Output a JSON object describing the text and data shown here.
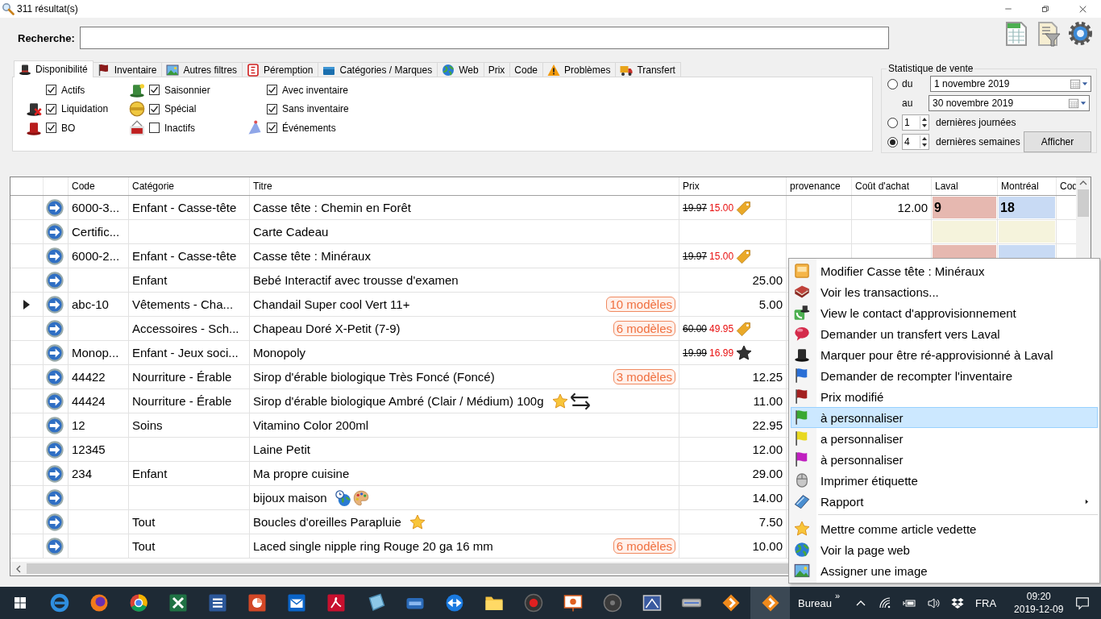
{
  "window": {
    "title": "311 résultat(s)"
  },
  "search": {
    "label": "Recherche:"
  },
  "tabs": [
    {
      "label": "Disponibilité",
      "kind": "hat",
      "selected": true
    },
    {
      "label": "Inventaire",
      "kind": "flag",
      "selected": false
    },
    {
      "label": "Autres filtres",
      "kind": "picture",
      "selected": false
    },
    {
      "label": "Péremption",
      "kind": "expiry",
      "selected": false
    },
    {
      "label": "Catégories / Marques",
      "kind": "box",
      "selected": false
    },
    {
      "label": "Web",
      "kind": "globe",
      "selected": false
    },
    {
      "label": "Prix",
      "selected": false
    },
    {
      "label": "Code",
      "selected": false
    },
    {
      "label": "Problèmes",
      "kind": "warning",
      "selected": false
    },
    {
      "label": "Transfert",
      "kind": "truck",
      "selected": false
    }
  ],
  "filter_columns": [
    {
      "items": [
        {
          "label": "Actifs",
          "checked": true
        },
        {
          "label": "Liquidation",
          "kind": "hat-cross",
          "checked": true
        },
        {
          "label": "BO",
          "kind": "hat-red",
          "checked": true
        }
      ]
    },
    {
      "items": [
        {
          "label": "Saisonnier",
          "kind": "hat-green",
          "checked": true
        },
        {
          "label": "Spécial",
          "kind": "seal",
          "checked": true
        },
        {
          "label": "Inactifs",
          "kind": "sign",
          "checked": false
        }
      ]
    },
    {
      "items": [
        {
          "label": "Avec inventaire",
          "checked": true
        },
        {
          "label": "Sans inventaire",
          "checked": true
        },
        {
          "label": "Événements",
          "kind": "party-hat",
          "checked": true
        }
      ]
    }
  ],
  "sales_stats": {
    "title": "Statistique de vente",
    "range": {
      "selected": false,
      "from_label": "du",
      "from": "1 novembre 2019",
      "to_label": "au",
      "to": "30 novembre 2019"
    },
    "days": {
      "selected": false,
      "value": "1",
      "label": "dernières journées"
    },
    "weeks": {
      "selected": true,
      "value": "4",
      "label": "dernières semaines"
    },
    "button": "Afficher"
  },
  "grid": {
    "columns": [
      "Code",
      "Catégorie",
      "Titre",
      "Prix",
      "provenance",
      "Coût d'achat",
      "Laval",
      "Montréal",
      "Cod"
    ],
    "rows": [
      {
        "current": false,
        "code": "6000-3...",
        "category": "Enfant - Casse-tête",
        "title": "Casse tête : Chemin en Forêt",
        "price": {
          "old": "19.97",
          "new": "15.00",
          "marker": {
            "kind": "tag"
          }
        },
        "cost": "12.00",
        "stock_tracked": true,
        "laval": "9",
        "montreal": "18"
      },
      {
        "current": false,
        "code": "Certific...",
        "title": "Carte Cadeau",
        "stock_tracked": false
      },
      {
        "current": false,
        "code": "6000-2...",
        "category": "Enfant - Casse-tête",
        "title": "Casse tête : Minéraux",
        "price": {
          "old": "19.97",
          "new": "15.00",
          "marker": {
            "kind": "tag"
          }
        },
        "stock_tracked": true
      },
      {
        "current": false,
        "category": "Enfant",
        "title": "Bebé Interactif avec trousse d'examen",
        "price": {
          "value": "25.00"
        }
      },
      {
        "current": true,
        "code": "abc-10",
        "category": "Vêtements - Cha...",
        "title": "Chandail Super cool Vert 11+",
        "variants": "10 modèles",
        "price": {
          "value": "5.00"
        }
      },
      {
        "current": false,
        "category": "Accessoires - Sch...",
        "title": "Chapeau Doré X-Petit (7-9)",
        "variants": "6 modèles",
        "price": {
          "old": "60.00",
          "new": "49.95",
          "marker": {
            "kind": "tag"
          }
        }
      },
      {
        "current": false,
        "code": "Monop...",
        "category": "Enfant - Jeux soci...",
        "title": "Monopoly",
        "price": {
          "old": "19.99",
          "new": "16.99",
          "marker": {
            "kind": "star-dark"
          }
        }
      },
      {
        "current": false,
        "code": "44422",
        "category": "Nourriture - Érable",
        "title": "Sirop d'érable biologique Très Foncé (Foncé)",
        "variants": "3 modèles",
        "price": {
          "value": "12.25"
        }
      },
      {
        "current": false,
        "code": "44424",
        "category": "Nourriture - Érable",
        "title": "Sirop d'érable biologique Ambré (Clair / Médium) 100g",
        "title_icons": [
          {
            "kind": "star"
          },
          {
            "kind": "swap"
          }
        ],
        "price": {
          "value": "11.00"
        }
      },
      {
        "current": false,
        "code": "12",
        "category": "Soins",
        "title": "Vitamino Color 200ml",
        "price": {
          "value": "22.95"
        }
      },
      {
        "current": false,
        "code": "12345",
        "title": "Laine Petit",
        "price": {
          "value": "12.00"
        }
      },
      {
        "current": false,
        "code": "234",
        "category": "Enfant",
        "title": "Ma propre cuisine",
        "price": {
          "value": "29.00"
        }
      },
      {
        "current": false,
        "title": "bijoux maison",
        "title_icons": [
          {
            "kind": "globe-clock"
          },
          {
            "kind": "palette"
          }
        ],
        "price": {
          "value": "14.00"
        }
      },
      {
        "current": false,
        "category": "Tout",
        "title": "Boucles d'oreilles Parapluie",
        "title_icons": [
          {
            "kind": "star"
          }
        ],
        "price": {
          "value": "7.50"
        }
      },
      {
        "current": false,
        "category": "Tout",
        "title": "Laced single nipple ring Rouge 20 ga 16 mm",
        "variants": "6 modèles",
        "price": {
          "value": "10.00"
        }
      }
    ]
  },
  "context_menu": {
    "items": [
      {
        "kind": "edit",
        "label": "Modifier Casse tête : Minéraux",
        "selected": false
      },
      {
        "kind": "book",
        "label": "Voir les transactions...",
        "selected": false
      },
      {
        "kind": "contact",
        "label": "View le contact d'approvisionnement",
        "selected": false
      },
      {
        "kind": "bubble",
        "label": "Demander un transfert vers Laval",
        "selected": false
      },
      {
        "kind": "hat",
        "label": "Marquer pour être ré-approvisionné à Laval",
        "selected": false
      },
      {
        "kind": "flag",
        "color": "#2a6fd6",
        "label": "Demander de recompter l'inventaire",
        "selected": false
      },
      {
        "kind": "flag",
        "color": "#a32020",
        "label": "Prix modifié",
        "selected": false
      },
      {
        "kind": "flag",
        "color": "#3aa832",
        "label": "à personnaliser",
        "selected": true
      },
      {
        "kind": "flag",
        "color": "#e8d820",
        "label": "a personnaliser",
        "selected": false
      },
      {
        "kind": "flag",
        "color": "#c020c0",
        "label": "à personnaliser",
        "selected": false
      },
      {
        "kind": "mouse",
        "label": "Imprimer étiquette",
        "selected": false
      },
      {
        "kind": "books",
        "label": "Rapport",
        "selected": false,
        "submenu": true
      },
      {
        "kind": "separator"
      },
      {
        "kind": "star",
        "label": "Mettre comme article vedette",
        "selected": false
      },
      {
        "kind": "globe",
        "label": "Voir la page web",
        "selected": false
      },
      {
        "kind": "image",
        "label": "Assigner une image",
        "selected": false
      }
    ]
  },
  "taskbar": {
    "apps": [
      {
        "kind": "start",
        "selected": false
      },
      {
        "kind": "edge",
        "selected": false
      },
      {
        "kind": "firefox",
        "selected": false
      },
      {
        "kind": "chrome",
        "selected": false
      },
      {
        "kind": "excel",
        "selected": false
      },
      {
        "kind": "word",
        "selected": false
      },
      {
        "kind": "ppt",
        "selected": false
      },
      {
        "kind": "outlook",
        "selected": false
      },
      {
        "kind": "pdf",
        "selected": false
      },
      {
        "kind": "crystal",
        "selected": false
      },
      {
        "kind": "roam",
        "selected": false
      },
      {
        "kind": "remote",
        "selected": false
      },
      {
        "kind": "folder",
        "selected": false
      },
      {
        "kind": "record",
        "selected": false
      },
      {
        "kind": "presentation",
        "selected": false
      },
      {
        "kind": "disc",
        "selected": false
      },
      {
        "kind": "blueprint",
        "selected": false
      },
      {
        "kind": "scanner",
        "selected": false
      },
      {
        "kind": "diamond",
        "selected": false
      },
      {
        "kind": "diamond",
        "selected": true
      }
    ],
    "toolbar_label": "Bureau",
    "toolbar_more": "»",
    "language": "FRA",
    "time": "09:20",
    "date": "2019-12-09"
  }
}
